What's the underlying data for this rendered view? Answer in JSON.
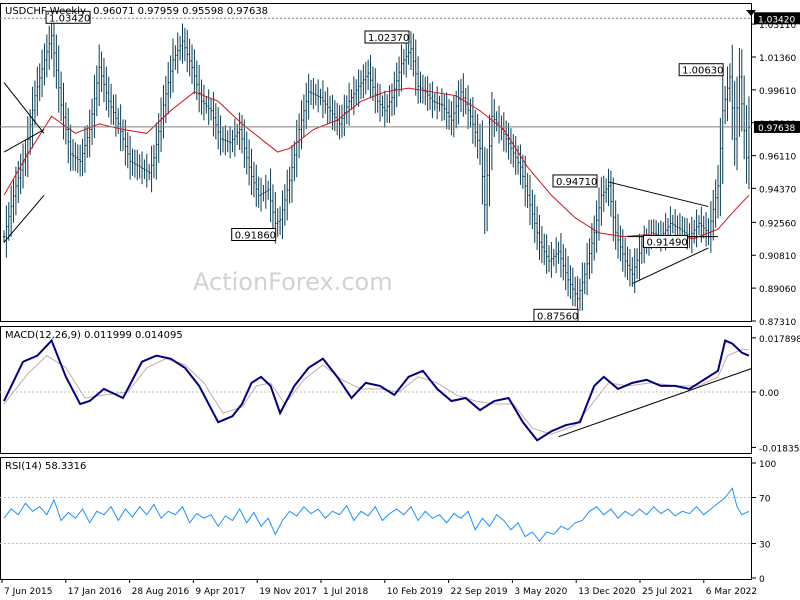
{
  "header": {
    "symbol": "USDCHF,Weekly",
    "ohlc": "0.96071 0.97959 0.95598 0.97638"
  },
  "watermark": "ActionForex.com",
  "colors": {
    "bars": "#0b3d52",
    "ma": "#d0151c",
    "macd_main": "#000080",
    "macd_signal": "#c8aaa8",
    "rsi": "#1e90ff",
    "trendline": "#000000",
    "level_line": "#808080",
    "current_label_bg": "#000000",
    "current_label_fg": "#ffffff"
  },
  "chart_data": [
    {
      "type": "line",
      "panel": "price",
      "y_ticks": [
        "1.03110",
        "1.01360",
        "0.99610",
        "0.97860",
        "0.96110",
        "0.94370",
        "0.92560",
        "0.90810",
        "0.89060",
        "0.87310"
      ],
      "ylim": [
        0.8731,
        1.0418
      ],
      "hline_top": 1.0342,
      "hline_current": 0.97638,
      "current_label": "0.97638",
      "top_label": "1.03420",
      "x_labels": [
        "7 Jun 2015",
        "17 Jan 2016",
        "28 Aug 2016",
        "9 Apr 2017",
        "19 Nov 2017",
        "1 Jul 2018",
        "10 Feb 2019",
        "22 Sep 2019",
        "3 May 2020",
        "13 Dec 2020",
        "25 Jul 2021",
        "6 Mar 2022"
      ],
      "annotations": [
        {
          "text": "1.03420",
          "x": 37,
          "y": 1.0342
        },
        {
          "text": "0.91860",
          "x": 115,
          "y": 0.9186
        },
        {
          "text": "1.02370",
          "x": 171,
          "y": 1.0237
        },
        {
          "text": "0.87560",
          "x": 242,
          "y": 0.8756
        },
        {
          "text": "0.94710",
          "x": 250,
          "y": 0.9471
        },
        {
          "text": "0.91490",
          "x": 288,
          "y": 0.9149
        },
        {
          "text": "1.00630",
          "x": 303,
          "y": 1.0063
        }
      ],
      "price_series": [
        [
          0,
          0.918
        ],
        [
          5,
          0.945
        ],
        [
          9,
          0.962
        ],
        [
          13,
          0.993
        ],
        [
          17,
          1.012
        ],
        [
          20,
          1.025
        ],
        [
          24,
          0.988
        ],
        [
          28,
          0.962
        ],
        [
          32,
          0.958
        ],
        [
          36,
          0.975
        ],
        [
          40,
          1.008
        ],
        [
          44,
          0.99
        ],
        [
          48,
          0.978
        ],
        [
          53,
          0.958
        ],
        [
          57,
          0.955
        ],
        [
          61,
          0.952
        ],
        [
          63,
          0.96
        ],
        [
          67,
          0.988
        ],
        [
          71,
          1.012
        ],
        [
          75,
          1.022
        ],
        [
          79,
          1.008
        ],
        [
          83,
          0.99
        ],
        [
          87,
          0.985
        ],
        [
          91,
          0.97
        ],
        [
          95,
          0.968
        ],
        [
          99,
          0.975
        ],
        [
          101,
          0.965
        ],
        [
          104,
          0.95
        ],
        [
          107,
          0.94
        ],
        [
          111,
          0.943
        ],
        [
          114,
          0.925
        ],
        [
          116,
          0.927
        ],
        [
          120,
          0.948
        ],
        [
          124,
          0.975
        ],
        [
          128,
          0.995
        ],
        [
          133,
          0.992
        ],
        [
          137,
          0.985
        ],
        [
          141,
          0.978
        ],
        [
          145,
          0.99
        ],
        [
          149,
          0.998
        ],
        [
          153,
          1.005
        ],
        [
          157,
          0.99
        ],
        [
          160,
          0.985
        ],
        [
          163,
          0.992
        ],
        [
          167,
          1.01
        ],
        [
          171,
          1.018
        ],
        [
          174,
          0.998
        ],
        [
          177,
          0.995
        ],
        [
          180,
          0.99
        ],
        [
          184,
          0.988
        ],
        [
          188,
          0.98
        ],
        [
          192,
          0.995
        ],
        [
          196,
          0.982
        ],
        [
          200,
          0.965
        ],
        [
          202,
          0.935
        ],
        [
          205,
          0.982
        ],
        [
          209,
          0.975
        ],
        [
          213,
          0.965
        ],
        [
          217,
          0.955
        ],
        [
          221,
          0.935
        ],
        [
          225,
          0.915
        ],
        [
          229,
          0.905
        ],
        [
          233,
          0.91
        ],
        [
          237,
          0.895
        ],
        [
          241,
          0.885
        ],
        [
          244,
          0.898
        ],
        [
          248,
          0.92
        ],
        [
          251,
          0.94
        ],
        [
          254,
          0.945
        ],
        [
          257,
          0.92
        ],
        [
          261,
          0.905
        ],
        [
          264,
          0.898
        ],
        [
          268,
          0.913
        ],
        [
          272,
          0.92
        ],
        [
          276,
          0.918
        ],
        [
          280,
          0.925
        ],
        [
          284,
          0.922
        ],
        [
          288,
          0.918
        ],
        [
          292,
          0.925
        ],
        [
          296,
          0.92
        ],
        [
          300,
          0.945
        ],
        [
          302,
          0.985
        ],
        [
          305,
          1.003
        ],
        [
          307,
          0.97
        ],
        [
          309,
          1.003
        ],
        [
          312,
          0.96
        ],
        [
          313,
          0.976
        ]
      ],
      "ma_series": [
        [
          0,
          0.94
        ],
        [
          10,
          0.962
        ],
        [
          20,
          0.982
        ],
        [
          30,
          0.973
        ],
        [
          40,
          0.978
        ],
        [
          50,
          0.975
        ],
        [
          60,
          0.973
        ],
        [
          70,
          0.985
        ],
        [
          80,
          0.995
        ],
        [
          90,
          0.99
        ],
        [
          100,
          0.978
        ],
        [
          110,
          0.968
        ],
        [
          115,
          0.963
        ],
        [
          120,
          0.965
        ],
        [
          130,
          0.975
        ],
        [
          140,
          0.98
        ],
        [
          150,
          0.99
        ],
        [
          160,
          0.995
        ],
        [
          170,
          0.997
        ],
        [
          180,
          0.995
        ],
        [
          190,
          0.993
        ],
        [
          200,
          0.985
        ],
        [
          210,
          0.975
        ],
        [
          220,
          0.955
        ],
        [
          230,
          0.94
        ],
        [
          240,
          0.928
        ],
        [
          250,
          0.92
        ],
        [
          260,
          0.918
        ],
        [
          270,
          0.919
        ],
        [
          280,
          0.918
        ],
        [
          290,
          0.917
        ],
        [
          300,
          0.922
        ],
        [
          307,
          0.932
        ],
        [
          313,
          0.94
        ]
      ]
    },
    {
      "type": "line",
      "panel": "indicator",
      "title": "MACD(12,26,9) 0.011999 0.014095",
      "y_ticks": [
        "0.017898",
        "0.00",
        "-0.018354"
      ],
      "ylim": [
        -0.0202,
        0.0195
      ],
      "main_series": [
        [
          0,
          -0.003
        ],
        [
          8,
          0.01
        ],
        [
          14,
          0.012
        ],
        [
          20,
          0.017
        ],
        [
          26,
          0.005
        ],
        [
          32,
          -0.004
        ],
        [
          36,
          -0.003
        ],
        [
          42,
          0.001
        ],
        [
          50,
          -0.002
        ],
        [
          58,
          0.01
        ],
        [
          64,
          0.012
        ],
        [
          70,
          0.011
        ],
        [
          76,
          0.008
        ],
        [
          82,
          0.002
        ],
        [
          90,
          -0.01
        ],
        [
          96,
          -0.008
        ],
        [
          100,
          -0.004
        ],
        [
          104,
          0.003
        ],
        [
          108,
          0.005
        ],
        [
          112,
          0.002
        ],
        [
          116,
          -0.007
        ],
        [
          122,
          0.002
        ],
        [
          128,
          0.008
        ],
        [
          134,
          0.011
        ],
        [
          140,
          0.005
        ],
        [
          146,
          -0.002
        ],
        [
          152,
          0.003
        ],
        [
          158,
          0.002
        ],
        [
          164,
          -0.001
        ],
        [
          170,
          0.005
        ],
        [
          176,
          0.007
        ],
        [
          182,
          0.001
        ],
        [
          188,
          -0.003
        ],
        [
          194,
          -0.002
        ],
        [
          200,
          -0.006
        ],
        [
          206,
          -0.003
        ],
        [
          212,
          -0.002
        ],
        [
          218,
          -0.01
        ],
        [
          224,
          -0.016
        ],
        [
          230,
          -0.013
        ],
        [
          236,
          -0.011
        ],
        [
          242,
          -0.01
        ],
        [
          248,
          0.002
        ],
        [
          252,
          0.005
        ],
        [
          258,
          0.001
        ],
        [
          264,
          0.003
        ],
        [
          270,
          0.004
        ],
        [
          276,
          0.002
        ],
        [
          282,
          0.002
        ],
        [
          288,
          0.001
        ],
        [
          294,
          0.004
        ],
        [
          300,
          0.007
        ],
        [
          303,
          0.017
        ],
        [
          306,
          0.016
        ],
        [
          310,
          0.013
        ],
        [
          313,
          0.012
        ]
      ],
      "signal_series": [
        [
          0,
          -0.004
        ],
        [
          10,
          0.006
        ],
        [
          18,
          0.012
        ],
        [
          26,
          0.008
        ],
        [
          34,
          -0.002
        ],
        [
          42,
          -0.001
        ],
        [
          52,
          0.0
        ],
        [
          60,
          0.008
        ],
        [
          68,
          0.011
        ],
        [
          76,
          0.009
        ],
        [
          84,
          0.003
        ],
        [
          92,
          -0.007
        ],
        [
          100,
          -0.005
        ],
        [
          106,
          0.002
        ],
        [
          112,
          0.003
        ],
        [
          118,
          -0.004
        ],
        [
          126,
          0.004
        ],
        [
          134,
          0.009
        ],
        [
          142,
          0.004
        ],
        [
          150,
          0.001
        ],
        [
          158,
          0.001
        ],
        [
          166,
          0.0
        ],
        [
          174,
          0.005
        ],
        [
          182,
          0.003
        ],
        [
          190,
          -0.001
        ],
        [
          198,
          -0.003
        ],
        [
          206,
          -0.004
        ],
        [
          214,
          -0.004
        ],
        [
          222,
          -0.012
        ],
        [
          230,
          -0.014
        ],
        [
          240,
          -0.011
        ],
        [
          248,
          -0.003
        ],
        [
          254,
          0.003
        ],
        [
          262,
          0.002
        ],
        [
          272,
          0.003
        ],
        [
          282,
          0.002
        ],
        [
          292,
          0.002
        ],
        [
          300,
          0.005
        ],
        [
          304,
          0.012
        ],
        [
          310,
          0.014
        ],
        [
          313,
          0.014
        ]
      ]
    },
    {
      "type": "line",
      "panel": "indicator",
      "title": "RSI(14) 58.3316",
      "y_ticks": [
        "100",
        "70",
        "30",
        "0"
      ],
      "ylim": [
        0,
        100
      ],
      "levels": [
        70,
        30
      ],
      "series": [
        [
          0,
          52
        ],
        [
          3,
          60
        ],
        [
          6,
          55
        ],
        [
          9,
          65
        ],
        [
          12,
          58
        ],
        [
          15,
          62
        ],
        [
          18,
          55
        ],
        [
          21,
          68
        ],
        [
          24,
          50
        ],
        [
          27,
          57
        ],
        [
          30,
          52
        ],
        [
          33,
          60
        ],
        [
          36,
          48
        ],
        [
          39,
          58
        ],
        [
          42,
          55
        ],
        [
          45,
          62
        ],
        [
          48,
          50
        ],
        [
          51,
          60
        ],
        [
          54,
          53
        ],
        [
          57,
          62
        ],
        [
          60,
          55
        ],
        [
          63,
          64
        ],
        [
          66,
          52
        ],
        [
          69,
          58
        ],
        [
          72,
          55
        ],
        [
          75,
          62
        ],
        [
          78,
          48
        ],
        [
          81,
          56
        ],
        [
          84,
          52
        ],
        [
          87,
          55
        ],
        [
          90,
          45
        ],
        [
          93,
          54
        ],
        [
          96,
          50
        ],
        [
          99,
          60
        ],
        [
          102,
          48
        ],
        [
          105,
          57
        ],
        [
          108,
          45
        ],
        [
          111,
          52
        ],
        [
          114,
          38
        ],
        [
          117,
          50
        ],
        [
          120,
          58
        ],
        [
          123,
          54
        ],
        [
          126,
          62
        ],
        [
          129,
          56
        ],
        [
          132,
          60
        ],
        [
          135,
          52
        ],
        [
          138,
          58
        ],
        [
          141,
          55
        ],
        [
          144,
          63
        ],
        [
          147,
          50
        ],
        [
          150,
          58
        ],
        [
          153,
          54
        ],
        [
          156,
          62
        ],
        [
          159,
          50
        ],
        [
          162,
          56
        ],
        [
          165,
          60
        ],
        [
          168,
          55
        ],
        [
          171,
          62
        ],
        [
          174,
          50
        ],
        [
          177,
          58
        ],
        [
          180,
          52
        ],
        [
          183,
          55
        ],
        [
          186,
          48
        ],
        [
          189,
          56
        ],
        [
          192,
          52
        ],
        [
          195,
          58
        ],
        [
          198,
          42
        ],
        [
          201,
          52
        ],
        [
          204,
          45
        ],
        [
          207,
          55
        ],
        [
          210,
          50
        ],
        [
          213,
          42
        ],
        [
          216,
          48
        ],
        [
          219,
          36
        ],
        [
          222,
          40
        ],
        [
          225,
          32
        ],
        [
          228,
          40
        ],
        [
          231,
          38
        ],
        [
          234,
          45
        ],
        [
          237,
          42
        ],
        [
          240,
          48
        ],
        [
          243,
          50
        ],
        [
          246,
          58
        ],
        [
          249,
          62
        ],
        [
          252,
          55
        ],
        [
          255,
          60
        ],
        [
          258,
          52
        ],
        [
          261,
          58
        ],
        [
          264,
          54
        ],
        [
          267,
          60
        ],
        [
          270,
          55
        ],
        [
          273,
          62
        ],
        [
          276,
          56
        ],
        [
          279,
          60
        ],
        [
          282,
          54
        ],
        [
          285,
          58
        ],
        [
          288,
          56
        ],
        [
          291,
          62
        ],
        [
          294,
          55
        ],
        [
          297,
          60
        ],
        [
          300,
          65
        ],
        [
          303,
          70
        ],
        [
          306,
          78
        ],
        [
          308,
          62
        ],
        [
          310,
          55
        ],
        [
          313,
          58
        ]
      ]
    }
  ]
}
